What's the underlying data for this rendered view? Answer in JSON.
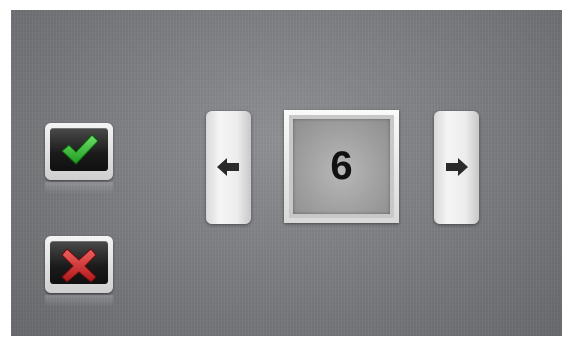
{
  "selector": {
    "value": "6"
  },
  "icons": {
    "confirm": "checkmark-icon",
    "cancel": "x-icon",
    "previous": "arrow-left-icon",
    "next": "arrow-right-icon"
  },
  "colors": {
    "confirm_accent": "#2db52d",
    "cancel_accent": "#d42a2a",
    "background": "#7b7d81"
  }
}
